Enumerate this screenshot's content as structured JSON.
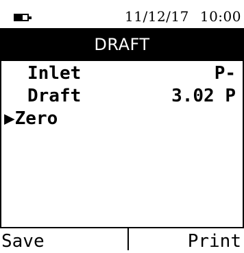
{
  "status_bar": {
    "battery_level": 0.6,
    "date": "11/12/17",
    "time": "10:00"
  },
  "screen": {
    "title": "DRAFT"
  },
  "readings": [
    {
      "label": "Inlet",
      "value": "P-"
    },
    {
      "label": "Draft",
      "value": "3.02 P"
    }
  ],
  "menu": {
    "selected_marker": "▶",
    "selected_item": "Zero"
  },
  "softkeys": {
    "left": "Save",
    "right": "Print"
  },
  "colors": {
    "foreground": "#000000",
    "background": "#ffffff"
  }
}
